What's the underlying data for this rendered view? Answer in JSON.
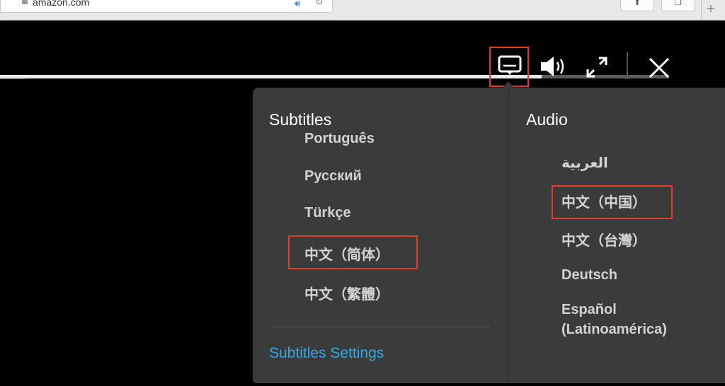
{
  "browser": {
    "url": "amazon.com",
    "icons": [
      "lock-icon",
      "speaker-icon",
      "reload-icon",
      "share-icon",
      "tabs-icon",
      "plus-icon"
    ],
    "new_tab_label": "+"
  },
  "player": {
    "progress_fraction": 0.81,
    "controls": [
      "subtitles-icon",
      "volume-icon",
      "fullscreen-icon",
      "close-icon"
    ]
  },
  "menu": {
    "subtitles": {
      "title": "Subtitles",
      "options": [
        "Português",
        "Русский",
        "Türkçe",
        "中文（简体）",
        "中文（繁體）"
      ],
      "selected": "中文（简体）",
      "settings_link": "Subtitles Settings"
    },
    "audio": {
      "title": "Audio",
      "options": [
        "العربية",
        "中文（中国）",
        "中文（台灣）",
        "Deutsch",
        "Español (Latinoamérica)"
      ],
      "option_lines": [
        "Español",
        "(Latinoamérica)"
      ],
      "selected": "中文（中国）"
    }
  },
  "colors": {
    "panel_bg": "#3b3b3b",
    "option_text": "#d3d3d3",
    "link": "#2fa9e4",
    "highlight_border": "#e03b2e"
  }
}
